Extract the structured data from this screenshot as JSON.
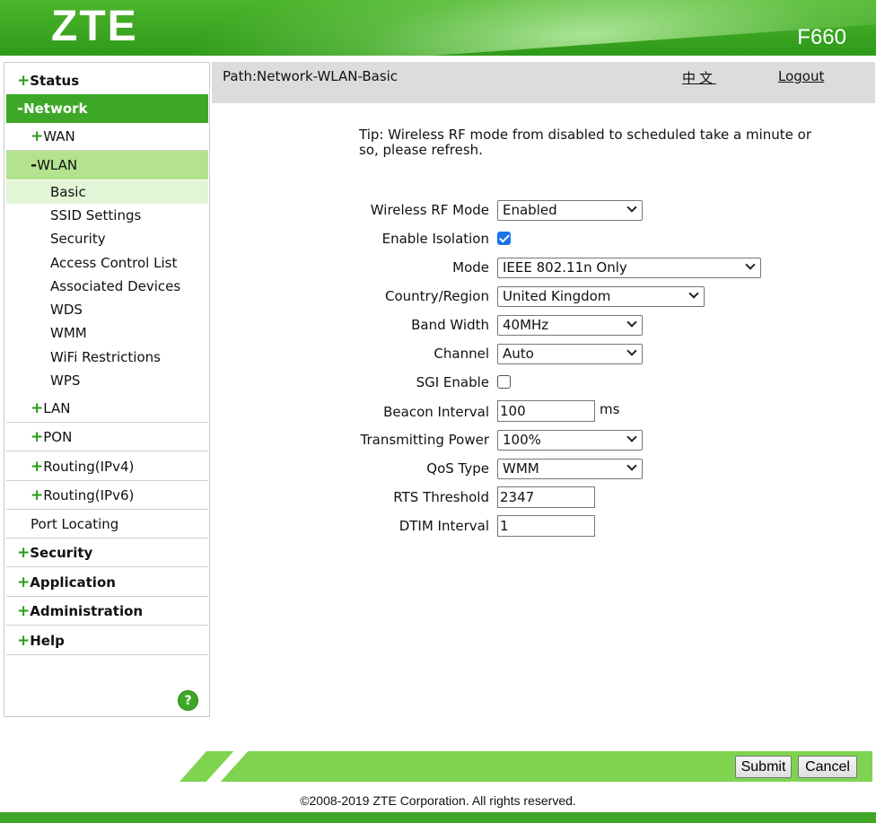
{
  "header": {
    "logo": "ZTE",
    "model": "F660"
  },
  "sidebar": {
    "status": {
      "prefix": "+",
      "label": "Status"
    },
    "network": {
      "prefix": "-",
      "label": "Network"
    },
    "wan": {
      "prefix": "+",
      "label": "WAN"
    },
    "wlan": {
      "prefix": "-",
      "label": "WLAN"
    },
    "wlan_items": [
      "Basic",
      "SSID Settings",
      "Security",
      "Access Control List",
      "Associated Devices",
      "WDS",
      "WMM",
      "WiFi Restrictions",
      "WPS"
    ],
    "lan": {
      "prefix": "+",
      "label": "LAN"
    },
    "pon": {
      "prefix": "+",
      "label": "PON"
    },
    "routing_v4": {
      "prefix": "+",
      "label": "Routing(IPv4)"
    },
    "routing_v6": {
      "prefix": "+",
      "label": "Routing(IPv6)"
    },
    "port_locating": {
      "label": "Port Locating"
    },
    "security": {
      "prefix": "+",
      "label": "Security"
    },
    "application": {
      "prefix": "+",
      "label": "Application"
    },
    "administration": {
      "prefix": "+",
      "label": "Administration"
    },
    "help": {
      "prefix": "+",
      "label": "Help"
    },
    "help_button": "?"
  },
  "pathbar": {
    "path": "Path:Network-WLAN-Basic",
    "language": "中文",
    "logout": "Logout"
  },
  "tip": "Tip: Wireless RF mode from disabled to scheduled take a minute or so, please refresh.",
  "form": {
    "rf_mode": {
      "label": "Wireless RF Mode",
      "value": "Enabled"
    },
    "isolation": {
      "label": "Enable Isolation",
      "checked": true
    },
    "mode": {
      "label": "Mode",
      "value": "IEEE 802.11n Only"
    },
    "country": {
      "label": "Country/Region",
      "value": "United Kingdom"
    },
    "bandwidth": {
      "label": "Band Width",
      "value": "40MHz"
    },
    "channel": {
      "label": "Channel",
      "value": "Auto"
    },
    "sgi": {
      "label": "SGI Enable",
      "checked": false
    },
    "beacon": {
      "label": "Beacon Interval",
      "value": "100",
      "unit": "ms"
    },
    "tx_power": {
      "label": "Transmitting Power",
      "value": "100%"
    },
    "qos": {
      "label": "QoS Type",
      "value": "WMM"
    },
    "rts": {
      "label": "RTS Threshold",
      "value": "2347"
    },
    "dtim": {
      "label": "DTIM Interval",
      "value": "1"
    }
  },
  "buttons": {
    "submit": "Submit",
    "cancel": "Cancel"
  },
  "footer": {
    "copyright": "©2008-2019 ZTE Corporation. All rights reserved."
  },
  "colors": {
    "brand_green": "#3da827",
    "active_sub": "#b3e38f",
    "active_leaf": "#e2f5d7",
    "footer_green": "#7ed44f"
  }
}
